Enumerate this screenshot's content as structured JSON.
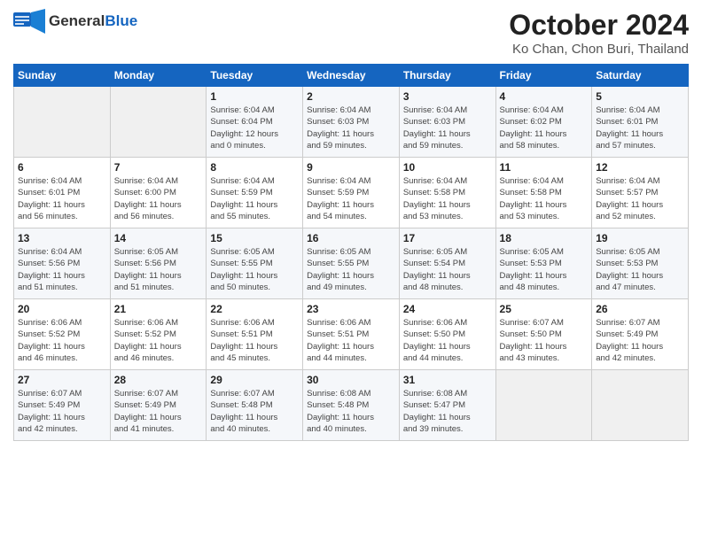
{
  "header": {
    "logo_general": "General",
    "logo_blue": "Blue",
    "title": "October 2024",
    "subtitle": "Ko Chan, Chon Buri, Thailand"
  },
  "weekdays": [
    "Sunday",
    "Monday",
    "Tuesday",
    "Wednesday",
    "Thursday",
    "Friday",
    "Saturday"
  ],
  "weeks": [
    [
      {
        "day": "",
        "info": ""
      },
      {
        "day": "",
        "info": ""
      },
      {
        "day": "1",
        "info": "Sunrise: 6:04 AM\nSunset: 6:04 PM\nDaylight: 12 hours\nand 0 minutes."
      },
      {
        "day": "2",
        "info": "Sunrise: 6:04 AM\nSunset: 6:03 PM\nDaylight: 11 hours\nand 59 minutes."
      },
      {
        "day": "3",
        "info": "Sunrise: 6:04 AM\nSunset: 6:03 PM\nDaylight: 11 hours\nand 59 minutes."
      },
      {
        "day": "4",
        "info": "Sunrise: 6:04 AM\nSunset: 6:02 PM\nDaylight: 11 hours\nand 58 minutes."
      },
      {
        "day": "5",
        "info": "Sunrise: 6:04 AM\nSunset: 6:01 PM\nDaylight: 11 hours\nand 57 minutes."
      }
    ],
    [
      {
        "day": "6",
        "info": "Sunrise: 6:04 AM\nSunset: 6:01 PM\nDaylight: 11 hours\nand 56 minutes."
      },
      {
        "day": "7",
        "info": "Sunrise: 6:04 AM\nSunset: 6:00 PM\nDaylight: 11 hours\nand 56 minutes."
      },
      {
        "day": "8",
        "info": "Sunrise: 6:04 AM\nSunset: 5:59 PM\nDaylight: 11 hours\nand 55 minutes."
      },
      {
        "day": "9",
        "info": "Sunrise: 6:04 AM\nSunset: 5:59 PM\nDaylight: 11 hours\nand 54 minutes."
      },
      {
        "day": "10",
        "info": "Sunrise: 6:04 AM\nSunset: 5:58 PM\nDaylight: 11 hours\nand 53 minutes."
      },
      {
        "day": "11",
        "info": "Sunrise: 6:04 AM\nSunset: 5:58 PM\nDaylight: 11 hours\nand 53 minutes."
      },
      {
        "day": "12",
        "info": "Sunrise: 6:04 AM\nSunset: 5:57 PM\nDaylight: 11 hours\nand 52 minutes."
      }
    ],
    [
      {
        "day": "13",
        "info": "Sunrise: 6:04 AM\nSunset: 5:56 PM\nDaylight: 11 hours\nand 51 minutes."
      },
      {
        "day": "14",
        "info": "Sunrise: 6:05 AM\nSunset: 5:56 PM\nDaylight: 11 hours\nand 51 minutes."
      },
      {
        "day": "15",
        "info": "Sunrise: 6:05 AM\nSunset: 5:55 PM\nDaylight: 11 hours\nand 50 minutes."
      },
      {
        "day": "16",
        "info": "Sunrise: 6:05 AM\nSunset: 5:55 PM\nDaylight: 11 hours\nand 49 minutes."
      },
      {
        "day": "17",
        "info": "Sunrise: 6:05 AM\nSunset: 5:54 PM\nDaylight: 11 hours\nand 48 minutes."
      },
      {
        "day": "18",
        "info": "Sunrise: 6:05 AM\nSunset: 5:53 PM\nDaylight: 11 hours\nand 48 minutes."
      },
      {
        "day": "19",
        "info": "Sunrise: 6:05 AM\nSunset: 5:53 PM\nDaylight: 11 hours\nand 47 minutes."
      }
    ],
    [
      {
        "day": "20",
        "info": "Sunrise: 6:06 AM\nSunset: 5:52 PM\nDaylight: 11 hours\nand 46 minutes."
      },
      {
        "day": "21",
        "info": "Sunrise: 6:06 AM\nSunset: 5:52 PM\nDaylight: 11 hours\nand 46 minutes."
      },
      {
        "day": "22",
        "info": "Sunrise: 6:06 AM\nSunset: 5:51 PM\nDaylight: 11 hours\nand 45 minutes."
      },
      {
        "day": "23",
        "info": "Sunrise: 6:06 AM\nSunset: 5:51 PM\nDaylight: 11 hours\nand 44 minutes."
      },
      {
        "day": "24",
        "info": "Sunrise: 6:06 AM\nSunset: 5:50 PM\nDaylight: 11 hours\nand 44 minutes."
      },
      {
        "day": "25",
        "info": "Sunrise: 6:07 AM\nSunset: 5:50 PM\nDaylight: 11 hours\nand 43 minutes."
      },
      {
        "day": "26",
        "info": "Sunrise: 6:07 AM\nSunset: 5:49 PM\nDaylight: 11 hours\nand 42 minutes."
      }
    ],
    [
      {
        "day": "27",
        "info": "Sunrise: 6:07 AM\nSunset: 5:49 PM\nDaylight: 11 hours\nand 42 minutes."
      },
      {
        "day": "28",
        "info": "Sunrise: 6:07 AM\nSunset: 5:49 PM\nDaylight: 11 hours\nand 41 minutes."
      },
      {
        "day": "29",
        "info": "Sunrise: 6:07 AM\nSunset: 5:48 PM\nDaylight: 11 hours\nand 40 minutes."
      },
      {
        "day": "30",
        "info": "Sunrise: 6:08 AM\nSunset: 5:48 PM\nDaylight: 11 hours\nand 40 minutes."
      },
      {
        "day": "31",
        "info": "Sunrise: 6:08 AM\nSunset: 5:47 PM\nDaylight: 11 hours\nand 39 minutes."
      },
      {
        "day": "",
        "info": ""
      },
      {
        "day": "",
        "info": ""
      }
    ]
  ]
}
